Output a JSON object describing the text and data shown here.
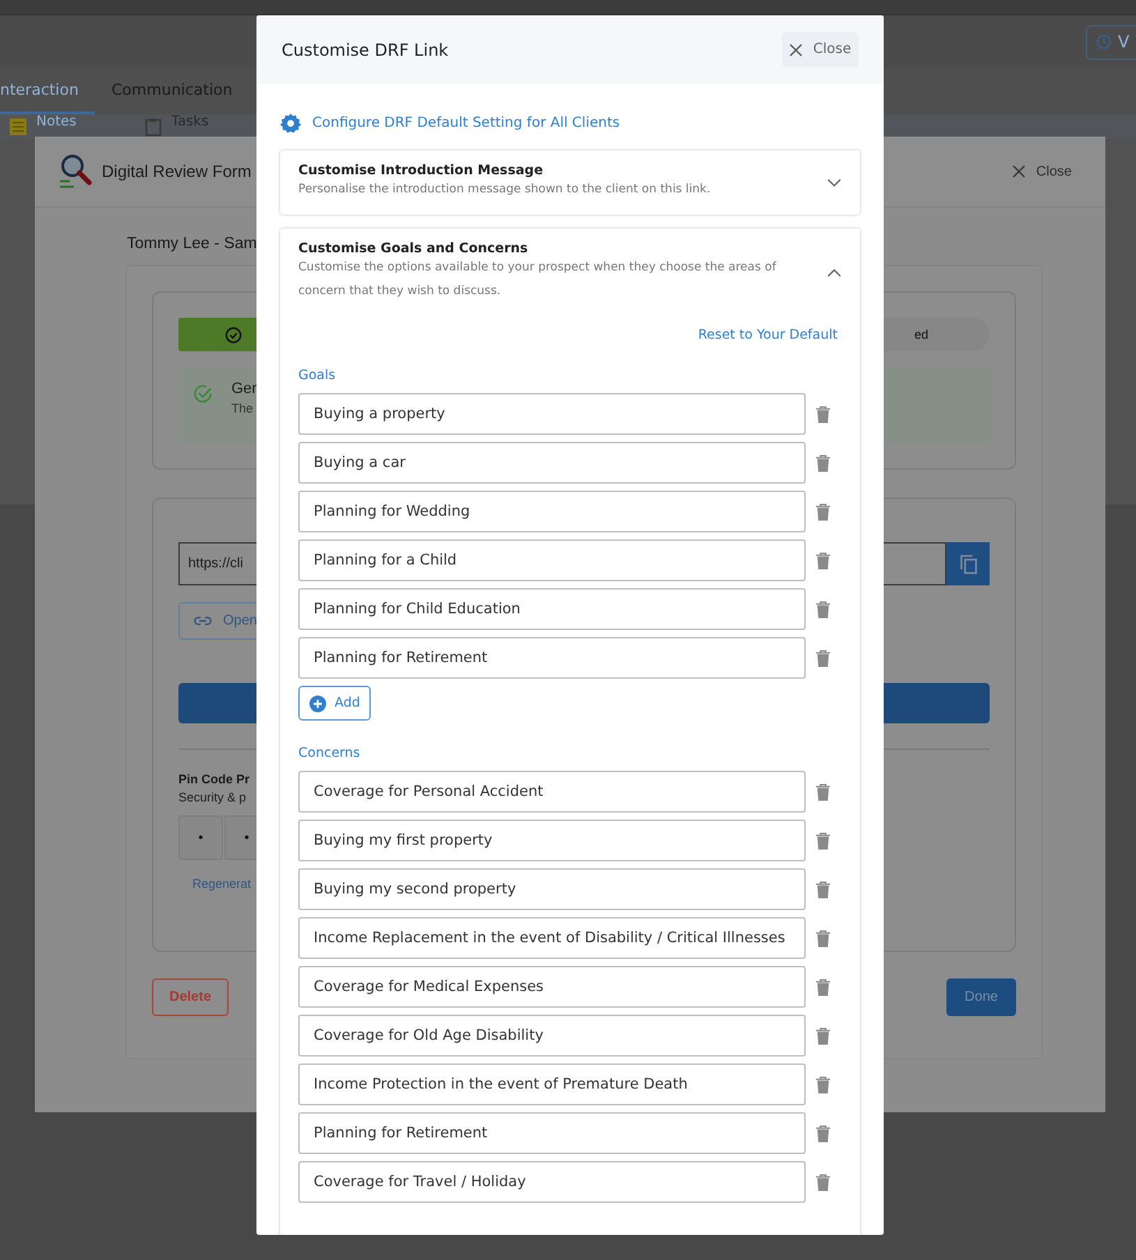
{
  "page": {
    "header_button": "V",
    "tabs": [
      {
        "label": "nteraction",
        "selected": true
      },
      {
        "label": "Communication",
        "selected": false
      }
    ],
    "subtabs": [
      {
        "label": "Notes",
        "selected": true
      },
      {
        "label": "Tasks",
        "selected": false
      }
    ]
  },
  "review_modal": {
    "title": "Digital Review Form",
    "close": "Close",
    "client": "Tommy Lee - Sam",
    "status": "ed",
    "notice_title": "Ger",
    "notice_text": "The",
    "link": "https://cli",
    "open_button": "Open",
    "pin_title": "Pin Code Pr",
    "pin_subtitle": "Security & p",
    "pin_digits": [
      "•",
      "•"
    ],
    "regenerate": "Regenerat",
    "delete": "Delete",
    "done": "Done"
  },
  "dialog": {
    "title": "Customise DRF Link",
    "close": "Close",
    "configure_link": "Configure DRF Default Setting for All Clients",
    "sections": [
      {
        "title": "Customise Introduction Message",
        "description": "Personalise the introduction message shown to the client on this link.",
        "expanded": false
      },
      {
        "title": "Customise Goals and Concerns",
        "description": "Customise the options available to your prospect when they choose the areas of concern that they wish to discuss.",
        "expanded": true
      }
    ],
    "reset_link": "Reset to Your Default",
    "goals_label": "Goals",
    "goals": [
      "Buying a property",
      "Buying a car",
      "Planning for Wedding",
      "Planning for a Child",
      "Planning for Child Education",
      "Planning for Retirement"
    ],
    "add_button": "Add",
    "concerns_label": "Concerns",
    "concerns": [
      "Coverage for Personal Accident",
      "Buying my first property",
      "Buying my second property",
      "Income Replacement in the event of Disability / Critical Illnesses",
      "Coverage for Medical Expenses",
      "Coverage for Old Age Disability",
      "Income Protection in the event of Premature Death",
      "Planning for Retirement",
      "Coverage for Travel / Holiday"
    ]
  }
}
